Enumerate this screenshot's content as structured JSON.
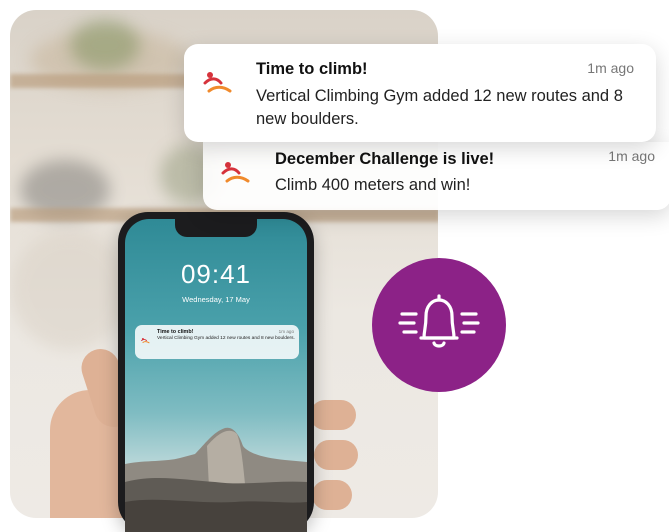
{
  "colors": {
    "accent": "#8c2287",
    "logo_red": "#d6333c",
    "logo_orange": "#f08a2c"
  },
  "notifications": [
    {
      "icon": "climber-logo-icon",
      "title": "Time to climb!",
      "time": "1m ago",
      "body": "Vertical Climbing Gym added 12 new routes and 8 new boulders."
    },
    {
      "icon": "climber-logo-icon",
      "title": "December Challenge is live!",
      "time": "1m ago",
      "body": "Climb 400 meters and win!"
    }
  ],
  "phone": {
    "time": "09:41",
    "date": "Wednesday, 17 May",
    "notification": {
      "title": "Time to climb!",
      "time": "1m ago",
      "body": "Vertical Climbing Gym added 12 new routes and 8 new boulders."
    }
  },
  "badge": {
    "icon": "ringing-bell-icon"
  }
}
